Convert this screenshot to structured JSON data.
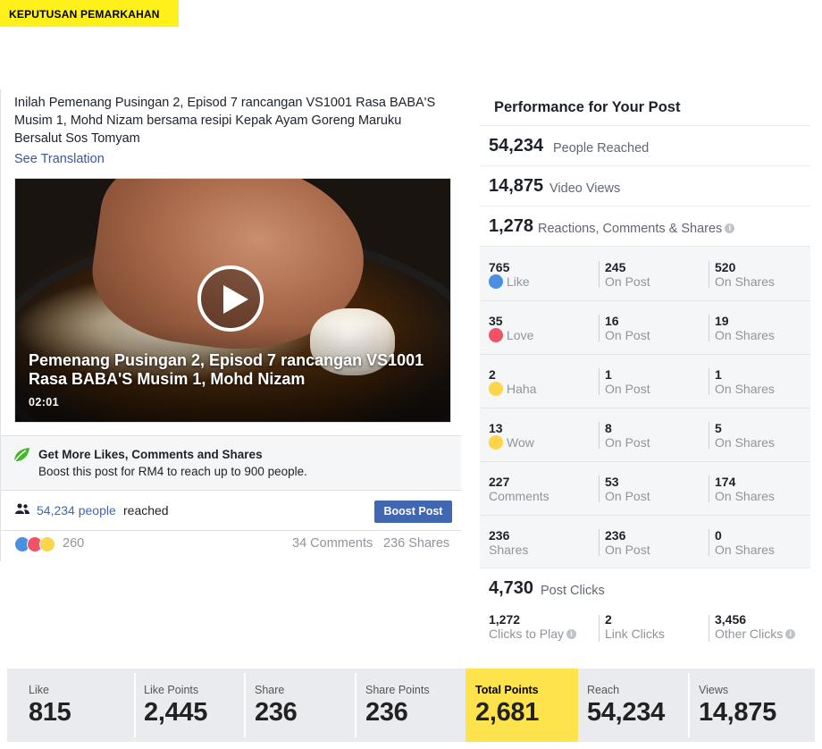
{
  "tag": "KEPUTUSAN PEMARKAHAN",
  "post": {
    "caption": "Inilah Pemenang Pusingan 2, Episod 7 rancangan VS1001 Rasa BABA'S Musim 1, Mohd Nizam bersama resipi Kepak Ayam Goreng Maruku Bersalut Sos Tomyam",
    "see_translation": "See Translation",
    "video_title": "Pemenang Pusingan 2, Episod 7 rancangan VS1001 Rasa BABA'S Musim 1, Mohd Nizam",
    "video_duration": "02:01",
    "boost_title": "Get More Likes, Comments and Shares",
    "boost_sub": "Boost this post for RM4 to reach up to 900 people.",
    "reach_link": "54,234 people",
    "reach_word": "reached",
    "boost_button": "Boost Post",
    "reaction_count": "260",
    "comments": "34 Comments",
    "shares": "236 Shares"
  },
  "performance": {
    "title": "Performance for Your Post",
    "people_reached": {
      "value": "54,234",
      "label": "People Reached"
    },
    "video_views": {
      "value": "14,875",
      "label": "Video Views"
    },
    "engagement": {
      "value": "1,278",
      "label": "Reactions, Comments & Shares"
    },
    "rows": [
      {
        "total": "765",
        "label": "Like",
        "icon": "like-icon",
        "on_post": "245",
        "on_post_label": "On Post",
        "on_shares": "520",
        "on_shares_label": "On Shares"
      },
      {
        "total": "35",
        "label": "Love",
        "icon": "love-icon",
        "on_post": "16",
        "on_post_label": "On Post",
        "on_shares": "19",
        "on_shares_label": "On Shares"
      },
      {
        "total": "2",
        "label": "Haha",
        "icon": "haha-icon",
        "on_post": "1",
        "on_post_label": "On Post",
        "on_shares": "1",
        "on_shares_label": "On Shares"
      },
      {
        "total": "13",
        "label": "Wow",
        "icon": "wow-icon",
        "on_post": "8",
        "on_post_label": "On Post",
        "on_shares": "5",
        "on_shares_label": "On Shares"
      },
      {
        "total": "227",
        "label": "Comments",
        "icon": "",
        "on_post": "53",
        "on_post_label": "On Post",
        "on_shares": "174",
        "on_shares_label": "On Shares"
      },
      {
        "total": "236",
        "label": "Shares",
        "icon": "",
        "on_post": "236",
        "on_post_label": "On Post",
        "on_shares": "0",
        "on_shares_label": "On Shares"
      }
    ],
    "post_clicks": {
      "value": "4,730",
      "label": "Post Clicks"
    },
    "clicks": [
      {
        "value": "1,272",
        "label": "Clicks to Play"
      },
      {
        "value": "2",
        "label": "Link Clicks"
      },
      {
        "value": "3,456",
        "label": "Other Clicks"
      }
    ]
  },
  "scores": [
    {
      "caption": "Like",
      "value": "815"
    },
    {
      "caption": "Like Points",
      "value": "2,445"
    },
    {
      "caption": "Share",
      "value": "236"
    },
    {
      "caption": "Share Points",
      "value": "236"
    },
    {
      "caption": "Total Points",
      "value": "2,681"
    },
    {
      "caption": "Reach",
      "value": "54,234"
    },
    {
      "caption": "Views",
      "value": "14,875"
    }
  ],
  "colors": {
    "tag_yellow": "#fef01b",
    "total_highlight": "#fee34c",
    "facebook_blue": "#4267b2",
    "link_blue": "#385898"
  }
}
